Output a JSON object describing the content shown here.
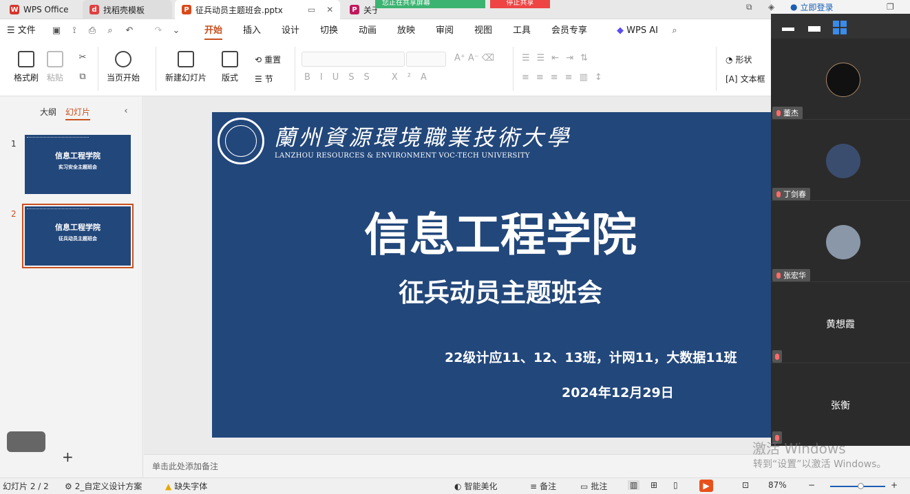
{
  "tabs": [
    {
      "label": "WPS Office",
      "logo": "W",
      "color": "#d6342a"
    },
    {
      "label": "找稻壳模板",
      "logo": "d",
      "color": "#e04040"
    },
    {
      "label": "征兵动员主题班会.pptx",
      "logo": "P",
      "color": "#d84a1b"
    },
    {
      "label": "关于",
      "logo": "P",
      "color": "#c2185b"
    }
  ],
  "share_bar": {
    "green": "您正在共享屏幕",
    "red": "停止共享"
  },
  "login": "立即登录",
  "menu": {
    "file": "文件",
    "items": [
      "开始",
      "插入",
      "设计",
      "切换",
      "动画",
      "放映",
      "审阅",
      "视图",
      "工具",
      "会员专享"
    ],
    "ai": "WPS AI"
  },
  "ribbon": {
    "format_painter": "格式刷",
    "paste": "粘贴",
    "from_current": "当页开始",
    "new_slide": "新建幻灯片",
    "layout": "版式",
    "reset": "重置",
    "section": "节",
    "shape": "形状",
    "textbox": "文本框"
  },
  "left_panel": {
    "outline_tab": "大纲",
    "slides_tab": "幻灯片",
    "thumbs": [
      {
        "num": "1",
        "title": "信息工程学院",
        "subtitle": "实习安全主题班会"
      },
      {
        "num": "2",
        "title": "信息工程学院",
        "subtitle": "征兵动员主题班会"
      }
    ]
  },
  "slide": {
    "university_cn": "蘭州資源環境職業技術大學",
    "university_en": "LANZHOU RESOURCES & ENVIRONMENT VOC-TECH UNIVERSITY",
    "title": "信息工程学院",
    "subtitle": "征兵动员主题班会",
    "classes": "22级计应11、12、13班，计网11，大数据11班",
    "date": "2024年12月29日"
  },
  "notes_placeholder": "单击此处添加备注",
  "status": {
    "slide_counter": "幻灯片 2 / 2",
    "design": "2_自定义设计方案",
    "missing_font": "缺失字体",
    "beautify": "智能美化",
    "notes": "备注",
    "comments": "批注",
    "zoom": "87%"
  },
  "participants": [
    "董杰",
    "丁剑春",
    "张宏华",
    "黄想霞",
    "张衡"
  ],
  "watermark": {
    "line1": "激活 Windows",
    "line2": "转到“设置”以激活 Windows。"
  }
}
